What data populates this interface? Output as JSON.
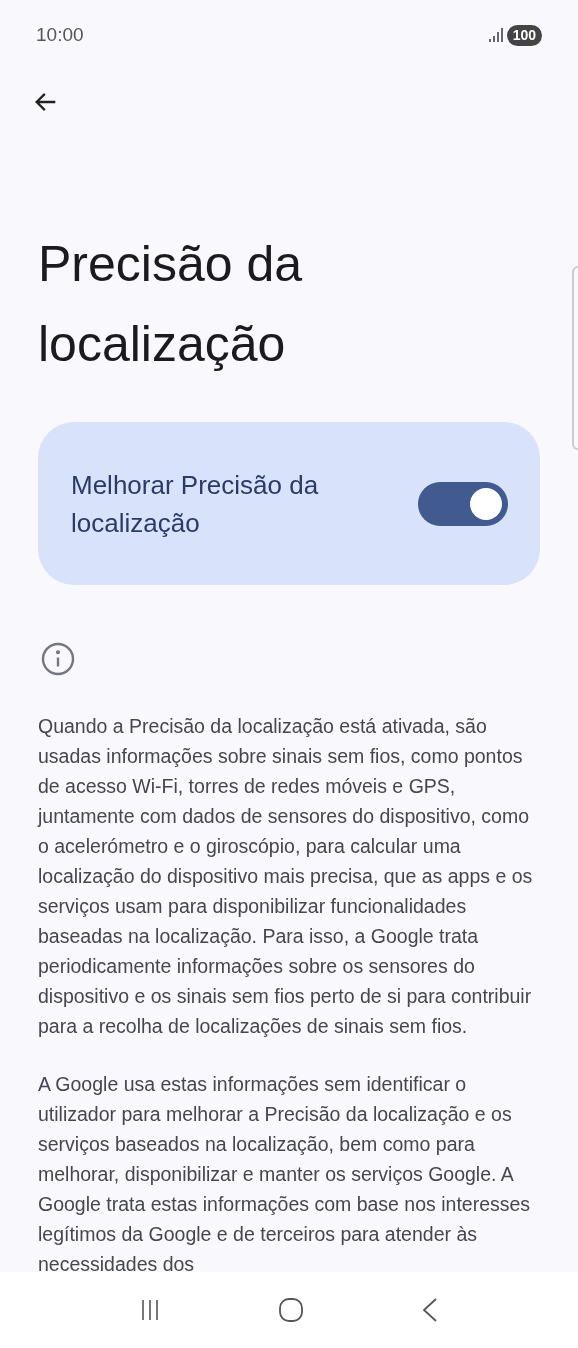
{
  "status_bar": {
    "time": "10:00",
    "battery": "100"
  },
  "title": "Precisão da localização",
  "setting": {
    "label": "Melhorar Precisão da localização",
    "on": true
  },
  "paragraphs": [
    "Quando a Precisão da localização está ativada, são usadas informações sobre sinais sem fios, como pontos de acesso Wi-Fi, torres de redes móveis e GPS, juntamente com dados de sensores do dispositivo, como o acelerómetro e o giroscópio, para calcular uma localização do dispositivo mais precisa, que as apps e os serviços usam para disponibilizar funcionalidades baseadas na localização. Para isso, a Google trata periodicamente informações sobre os sensores do dispositivo e os sinais sem fios perto de si para contribuir para a recolha de localizações de sinais sem fios.",
    "A Google usa estas informações sem identificar o utilizador para melhorar a Precisão da localização e os serviços baseados na localização, bem como para melhorar, disponibilizar e manter os serviços Google. A Google trata estas informações com base nos interesses legítimos da Google e de terceiros para atender às necessidades dos"
  ]
}
